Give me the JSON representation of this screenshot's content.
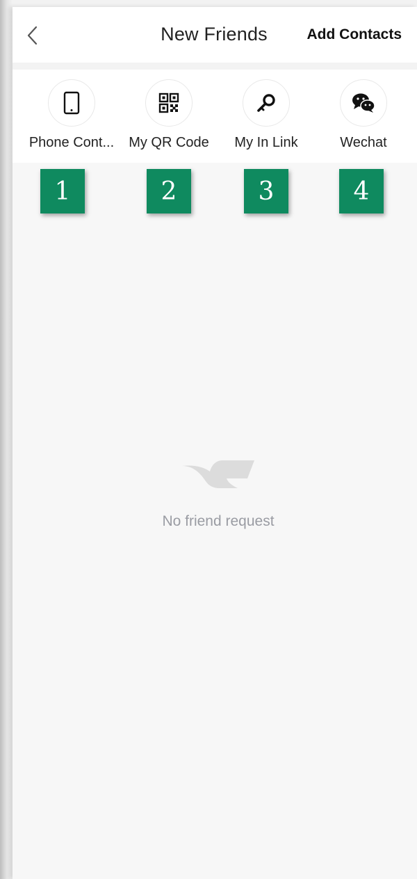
{
  "header": {
    "title": "New Friends",
    "action_label": "Add Contacts",
    "back_icon": "chevron-left-icon"
  },
  "shortcuts": [
    {
      "label": "Phone Cont...",
      "icon": "phone-icon"
    },
    {
      "label": "My QR Code",
      "icon": "qr-code-icon"
    },
    {
      "label": "My In Link",
      "icon": "key-link-icon"
    },
    {
      "label": "Wechat",
      "icon": "wechat-icon"
    }
  ],
  "annotations": [
    "1",
    "2",
    "3",
    "4"
  ],
  "empty_state": {
    "icon": "bird-logo-icon",
    "message": "No friend request"
  },
  "colors": {
    "annotation_badge": "#0f8a5f",
    "background": "#f7f7f7",
    "empty_text": "#9a9ca3"
  }
}
